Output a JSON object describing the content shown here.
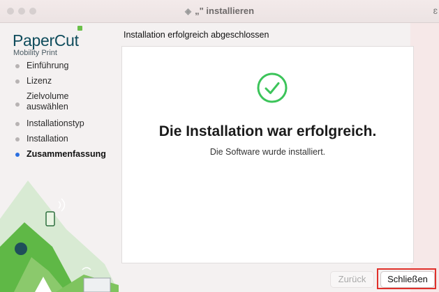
{
  "window": {
    "title": "„\" installieren",
    "traffic_lights": [
      "close",
      "minimize",
      "zoom"
    ]
  },
  "sidebar": {
    "logo": {
      "main": "PaperCut",
      "sub": "Mobility Print"
    },
    "steps": [
      {
        "label": "Einführung",
        "active": false
      },
      {
        "label": "Lizenz",
        "active": false
      },
      {
        "label": "Zielvolume auswählen",
        "active": false
      },
      {
        "label": "Installationstyp",
        "active": false
      },
      {
        "label": "Installation",
        "active": false
      },
      {
        "label": "Zusammenfassung",
        "active": true
      }
    ]
  },
  "main": {
    "heading": "Installation erfolgreich abgeschlossen",
    "success_title": "Die Installation war erfolgreich.",
    "success_subtitle": "Die Software wurde installiert."
  },
  "buttons": {
    "back_label": "Zurück",
    "back_enabled": false,
    "close_label": "Schließen"
  },
  "colors": {
    "accent_green": "#3cc45a",
    "brand_teal": "#0f4c5c",
    "active_step_blue": "#2a6fe0",
    "highlight_red": "#e0302a"
  }
}
